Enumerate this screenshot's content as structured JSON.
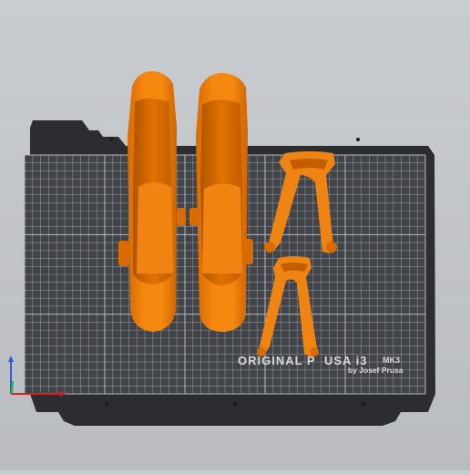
{
  "app": {
    "view": "3d-plater"
  },
  "bed": {
    "brand_main_a": "ORIGINAL P",
    "brand_main_b": "USA i3",
    "brand_model": "MK3",
    "brand_sub": "by Josef Prusa",
    "surface_color": "#414449",
    "frame_color": "#2b2d31",
    "grid_color": "#8e9196"
  },
  "objects": [
    {
      "name": "left-wide-shroud",
      "color": "#f07f0a"
    },
    {
      "name": "right-wide-shroud",
      "color": "#f07f0a"
    },
    {
      "name": "top-fan-bracket",
      "color": "#f07f0a"
    },
    {
      "name": "bottom-fan-bracket",
      "color": "#f07f0a"
    }
  ],
  "axes": {
    "x_color": "#d32020",
    "y_color": "#1fbf3a",
    "z_color": "#2a5bd8"
  }
}
